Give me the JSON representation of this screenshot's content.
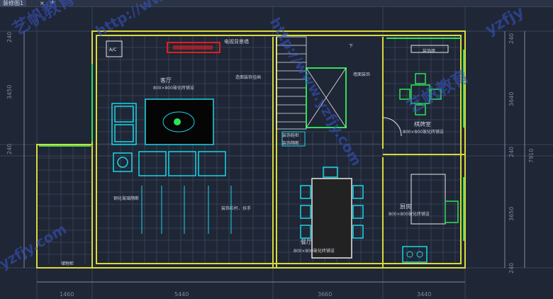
{
  "tab": {
    "title": "装修图1",
    "close": "×",
    "add": "+"
  },
  "dims": {
    "bottom": [
      "1460",
      "5440",
      "3660",
      "3440"
    ],
    "left": [
      "3450",
      "240",
      "240"
    ],
    "right": [
      "240",
      "3640",
      "7910",
      "240",
      "3650",
      "240"
    ]
  },
  "rooms": {
    "tv_wall": "电视背景墙",
    "living": "客厅",
    "living_floor": "800×800玻化砖铺设",
    "wall_deco_1": "造面装饰挂画",
    "wall_deco_2": "墙面装饰",
    "down": "下",
    "shoe_cabinet_label": "装饰鞋柜",
    "cabinet_label": "装饰隔断",
    "card_room": "棋牌室",
    "card_floor": "800×800玻化砖铺设",
    "deco_wall": "装饰墙",
    "rail": "装饰栏杆、扶手",
    "fish_cabinet": "钢化玻璃隔断",
    "dining": "餐厅",
    "dining_floor": "800×800玻化砖铺设",
    "kitchen": "厨房",
    "kitchen_floor": "800×800玻化砖铺设",
    "balcony": "储物柜",
    "ac": "A/C"
  },
  "watermarks": [
    "http://www.yzfjy.com",
    "艺帆教育",
    "yzfjy",
    "艺帆教育",
    "yzfjy.com",
    "http://www.yzfjy.com"
  ],
  "colors": {
    "bg": "#1f2635",
    "wall": "#d9d93a",
    "cyan": "#19d6e6",
    "green": "#2ee05a",
    "red": "#e01f1f",
    "dim": "#7f8aa0",
    "grid": "#3d4860"
  }
}
